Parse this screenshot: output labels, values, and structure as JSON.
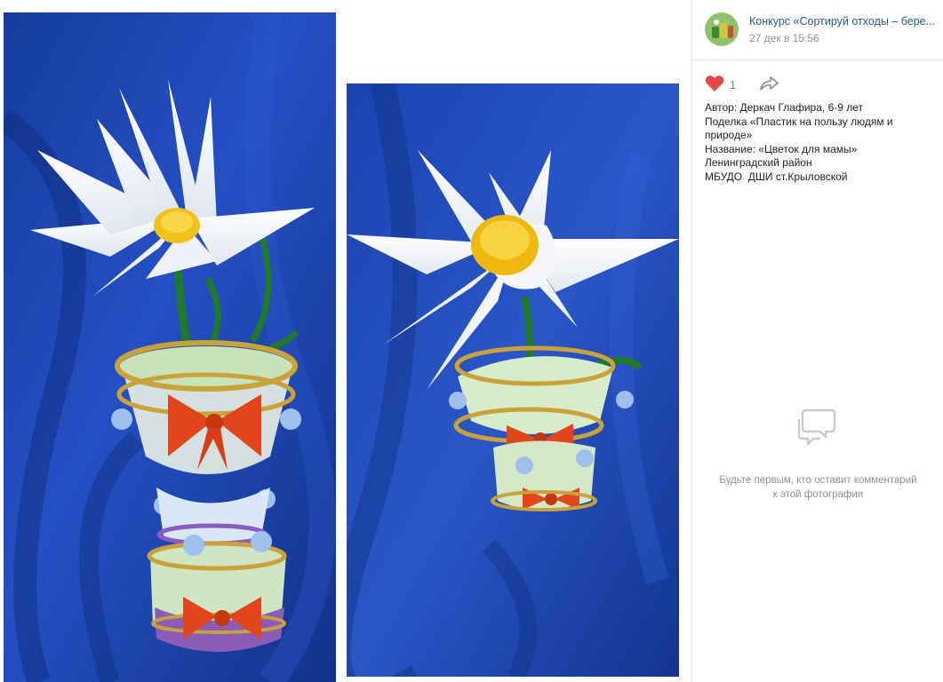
{
  "post": {
    "author": "Конкурс «Сортируй отходы – бере...",
    "date": "27 дек в 15:56"
  },
  "actions": {
    "like_count": "1",
    "like_icon": "heart-icon",
    "share_icon": "share-arrow-icon"
  },
  "description": {
    "lines": [
      "Автор: Деркач Глафира, 6-9 лет",
      "Поделка «Пластик на пользу людям и природе»",
      "Название: «Цветок для мамы»",
      "Ленинградский район",
      "МБУДО  ДШИ ст.Крыловской"
    ]
  },
  "comments": {
    "empty_text": "Будьте первым, кто оставит комментарий к этой фотографии",
    "icon": "comments-icon"
  },
  "colors": {
    "link": "#2a5885",
    "meta": "#939393",
    "like": "#e64646",
    "photo_background": "#1c3fa8"
  }
}
